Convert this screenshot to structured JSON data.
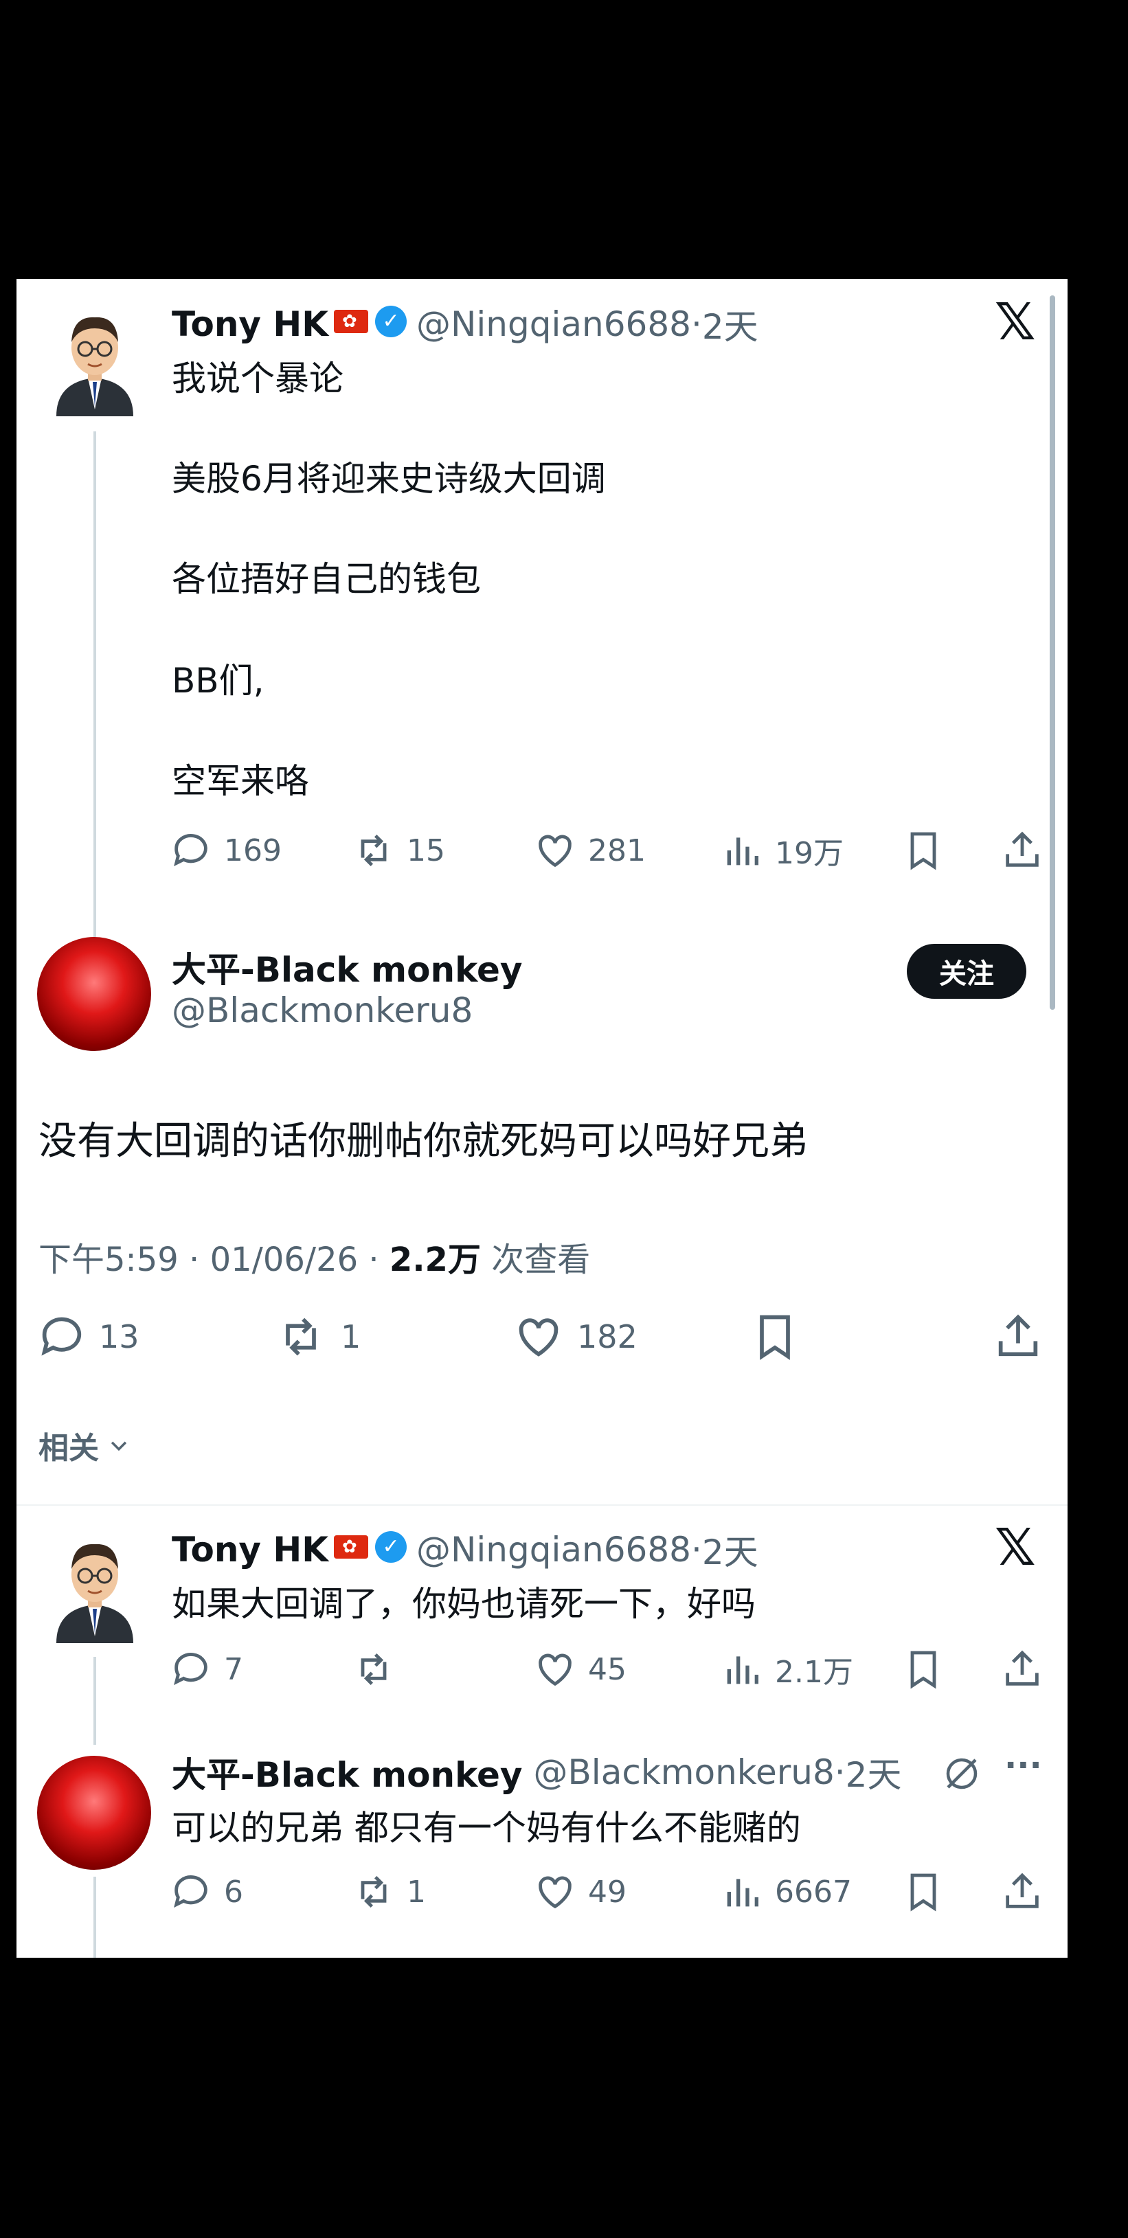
{
  "tweet1": {
    "name": "Tony HK",
    "handle": "@Ningqian6688",
    "time": "2天",
    "lines": [
      "我说个暴论",
      "美股6月将迎来史诗级大回调",
      "各位捂好自己的钱包",
      "BB们,",
      "空军来咯"
    ],
    "replies": "169",
    "retweets": "15",
    "likes": "281",
    "views": "19万"
  },
  "main": {
    "name": "大平-Black monkey",
    "handle": "@Blackmonkeru8",
    "follow_label": "关注",
    "text": "没有大回调的话你删帖你就死妈可以吗好兄弟",
    "time": "下午5:59 · 01/06/26 · ",
    "views": "2.2万",
    "views_label": " 次查看",
    "replies": "13",
    "retweets": "1",
    "likes": "182"
  },
  "related_label": "相关",
  "reply1": {
    "name": "Tony HK",
    "handle": "@Ningqian6688",
    "time": "2天",
    "text": "如果大回调了，你妈也请死一下，好吗",
    "replies": "7",
    "retweets": "",
    "likes": "45",
    "views": "2.1万"
  },
  "reply2": {
    "name": "大平-Black monkey",
    "handle": "@Blackmonkeru8",
    "time": "2天",
    "text": "可以的兄弟 都只有一个妈有什么不能赌的",
    "replies": "6",
    "retweets": "1",
    "likes": "49",
    "views": "6667"
  },
  "icons": {
    "x_logo": "𝕏",
    "verified": "✓",
    "more": "···"
  },
  "colors": {
    "text": "#0f1419",
    "secondary": "#536471",
    "verified": "#1d9bf0",
    "avatar_red": "#e01818"
  }
}
